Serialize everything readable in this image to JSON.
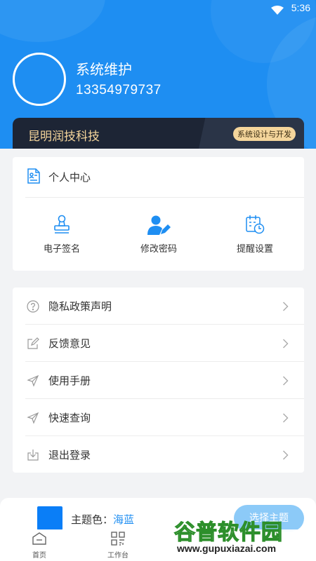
{
  "status_bar": {
    "time": "5:36",
    "icon": "wifi-icon"
  },
  "profile": {
    "name": "系统维护",
    "phone": "13354979737"
  },
  "company": {
    "name": "昆明润技科技",
    "tag": "系统设计与开发"
  },
  "personal_center": {
    "title": "个人中心",
    "icon": "profile-card-icon",
    "shortcuts": [
      {
        "label": "电子签名",
        "icon": "stamp-icon"
      },
      {
        "label": "修改密码",
        "icon": "user-edit-icon"
      },
      {
        "label": "提醒设置",
        "icon": "calendar-clock-icon"
      }
    ]
  },
  "menu": {
    "items": [
      {
        "label": "隐私政策声明",
        "icon": "question-circle-icon"
      },
      {
        "label": "反馈意见",
        "icon": "edit-icon"
      },
      {
        "label": "使用手册",
        "icon": "send-icon"
      },
      {
        "label": "快速查询",
        "icon": "send-icon"
      },
      {
        "label": "退出登录",
        "icon": "download-icon"
      }
    ]
  },
  "theme": {
    "label": "主题色：",
    "value": "海蓝",
    "swatch_color": "#0a7ef7",
    "button": "选择主题"
  },
  "tabs": [
    {
      "label": "首页",
      "icon": "home-icon"
    },
    {
      "label": "工作台",
      "icon": "grid-icon"
    }
  ],
  "watermark": {
    "text_cn": "谷普软件园",
    "url": "www.gupuxiazai.com"
  },
  "colors": {
    "primary": "#1e8ef2",
    "banner_bg": "#1d2535",
    "gold": "#f4d59b"
  }
}
